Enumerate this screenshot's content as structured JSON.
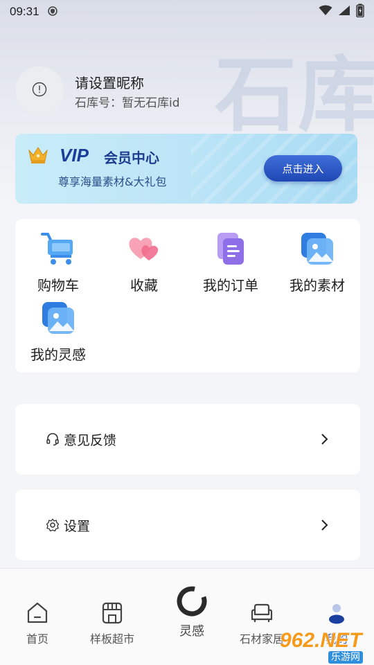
{
  "status_bar": {
    "time": "09:31"
  },
  "profile": {
    "nickname": "请设置昵称",
    "account_id_label": "石库号：",
    "account_id_value": "暂无石库id",
    "watermark": "石库"
  },
  "vip": {
    "logo_text": "VIP",
    "title": "会员中心",
    "subtitle": "尊享海量素材&大礼包",
    "enter_label": "点击进入"
  },
  "shortcuts": [
    {
      "label": "购物车",
      "icon": "shopping-cart-icon"
    },
    {
      "label": "收藏",
      "icon": "hearts-icon"
    },
    {
      "label": "我的订单",
      "icon": "order-document-icon"
    },
    {
      "label": "我的素材",
      "icon": "image-gallery-icon"
    },
    {
      "label": "我的灵感",
      "icon": "image-gallery-icon"
    }
  ],
  "menu": {
    "feedback_label": "意见反馈",
    "settings_label": "设置"
  },
  "bottom_nav": {
    "items": [
      {
        "label": "首页",
        "icon": "home-icon"
      },
      {
        "label": "样板超市",
        "icon": "store-icon"
      },
      {
        "label": "灵感",
        "icon": "inspiration-ring-icon"
      },
      {
        "label": "石材家居",
        "icon": "sofa-icon"
      },
      {
        "label": "我的",
        "icon": "person-icon",
        "active": true
      }
    ]
  },
  "watermark_badge": {
    "main": "962.NET",
    "sub": "乐游网"
  },
  "colors": {
    "accent": "#1f47b4",
    "vip_title": "#1c3d8f",
    "active_nav": "#1a3f9e",
    "badge_orange": "#f59a1b"
  }
}
